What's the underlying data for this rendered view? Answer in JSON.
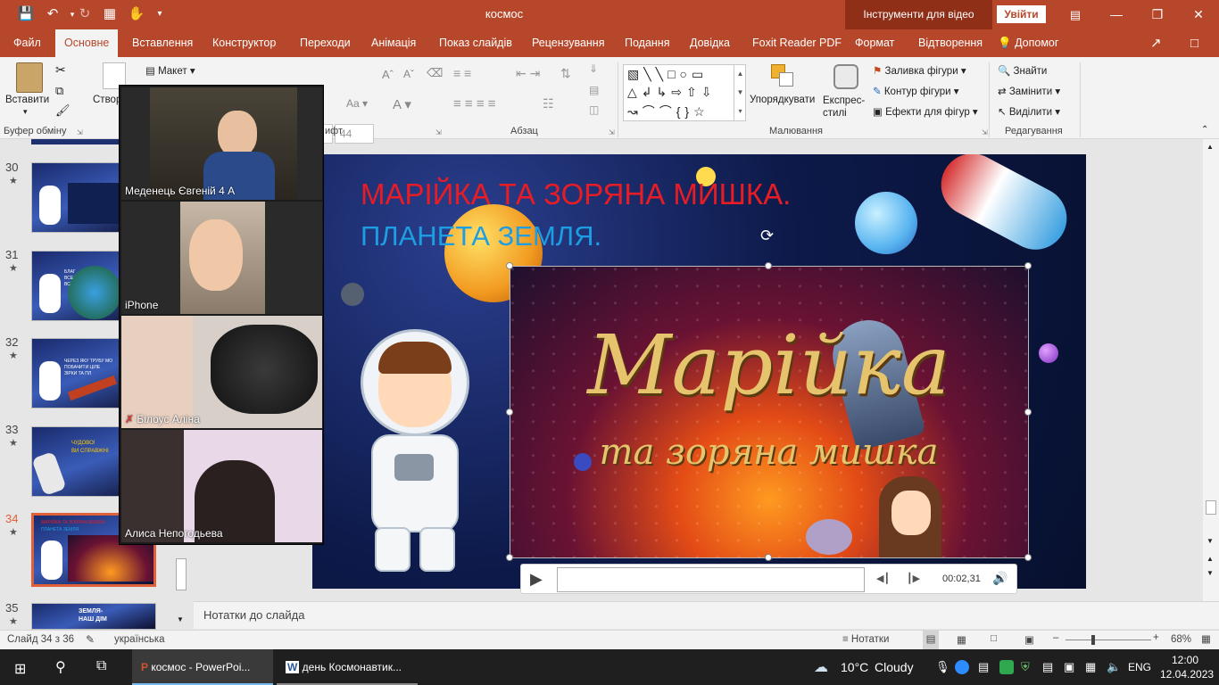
{
  "titlebar": {
    "document_title": "космос",
    "video_tools": "Інструменти для відео",
    "sign_in": "Увійти"
  },
  "menu": {
    "tabs": [
      "Файл",
      "Основне",
      "Вставлення",
      "Конструктор",
      "Переходи",
      "Анімація",
      "Показ слайдів",
      "Рецензування",
      "Подання",
      "Довідка",
      "Foxit Reader PDF",
      "Формат",
      "Відтворення"
    ],
    "help": "Допомог"
  },
  "ribbon": {
    "paste": "Вставити",
    "create_slide": "Створ слай",
    "layout": "Макет",
    "font_size": "44",
    "clipboard_group": "Буфер обміну",
    "font_group": "ифт",
    "paragraph_group": "Абзац",
    "drawing_group": "Малювання",
    "editing_group": "Редагування",
    "arrange": "Упорядкувати",
    "quick_styles": "Експрес-стилі",
    "shape_fill": "Заливка фігури",
    "shape_outline": "Контур фігури",
    "shape_effects": "Ефекти для фігур",
    "find": "Знайти",
    "replace": "Замінити",
    "select": "Виділити"
  },
  "slides": [
    {
      "num": "30",
      "caption": "",
      "lines": []
    },
    {
      "num": "31",
      "caption": "",
      "lines": [
        "БЛАГ",
        "ВСЕ",
        "ВС"
      ]
    },
    {
      "num": "32",
      "caption": "",
      "lines": [
        "ЧЕРЕЗ ЯКУ ТРУБУ МО",
        "ПОБАЧИТИ ЦІЛЕ",
        "ЗІРКИ ТА ПЛ"
      ]
    },
    {
      "num": "33",
      "caption": "",
      "lines": [
        "ЧУДОВО!",
        "ВИ СПРАВЖНІ"
      ]
    },
    {
      "num": "34",
      "caption": "",
      "lines": [
        "МАРІЙКА ТА ЗОРЯНА МИШКА",
        "ПЛАНЕТА ЗЕМЛЯ"
      ]
    },
    {
      "num": "35",
      "caption": "",
      "lines": [
        "ЗЕМЛЯ-",
        "НАШ ДІМ"
      ]
    }
  ],
  "participants": [
    {
      "name": "Меденець Євгеній 4 А",
      "muted": false
    },
    {
      "name": "iPhone",
      "muted": false
    },
    {
      "name": "Білоус Аліна",
      "muted": true
    },
    {
      "name": "Алиса Непогодьева",
      "muted": false
    }
  ],
  "slide": {
    "title_line1": "МАРІЙКА ТА ЗОРЯНА МИШКА.",
    "title_line2": "ПЛАНЕТА ЗЕМЛЯ.",
    "video_title": "Марійка",
    "video_subtitle": "та зоряна мишка"
  },
  "player": {
    "time": "00:02,31",
    "progress": 0.0
  },
  "notes": {
    "placeholder": "Нотатки до слайда"
  },
  "status": {
    "slide_counter": "Слайд 34 з 36",
    "language": "українська",
    "notes_btn": "Нотатки",
    "zoom": "68%"
  },
  "taskbar": {
    "apps": [
      "космос - PowerPoi...",
      "день Космонавтик..."
    ],
    "weather_temp": "10°C",
    "weather_desc": "Cloudy",
    "lang": "ENG",
    "time": "12:00",
    "date": "12.04.2023"
  },
  "colors": {
    "accent": "#b7472a",
    "title_red": "#e81c24",
    "title_blue": "#1e9ee2"
  }
}
